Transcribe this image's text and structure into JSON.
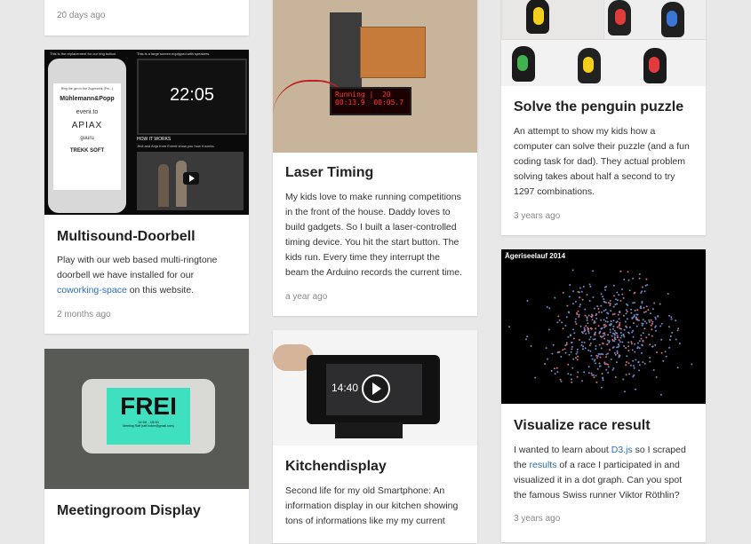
{
  "cards": {
    "c0": {
      "age": "20 days ago"
    },
    "doorbell": {
      "title": "Multisound-Doorbell",
      "desc_pre": "Play with our web based multi-ringtone doorbell we have installed for our ",
      "desc_link": "coworking-space",
      "desc_post": " on this website.",
      "age": "2 months ago",
      "thumb": {
        "caption_left": "This is the replacement for our ring button.",
        "caption_right": "This is a large screen equipped with speakers.",
        "phone_caption": "Ring the gen in the Zugerwerk (Pre...)",
        "logos": [
          "Mühlemann&Popp",
          "eveni.to",
          "APIAX",
          "guuru",
          "TREKK SOFT"
        ],
        "clock": "22:05",
        "how_title": "HOW IT WORKS",
        "how_text": "Jedi and Anja from Eventi show you how it works."
      }
    },
    "meeting": {
      "title": "Meetingroom Display",
      "thumb": {
        "label": "FREI",
        "sub1": "14:00 - 15:00",
        "sub2": "Meeting Raff (raff.hober@gmail.com)"
      }
    },
    "laser": {
      "title": "Laser Timing",
      "desc": "My kids love to make running competitions in the front of the house. Daddy loves to build gadgets. So I built a laser-controlled timing device. You hit the start button. The kids run. Every time they interrupt the beam the Arduino records the current time.",
      "age": "a year ago",
      "thumb": {
        "lcd_line1": "Running |  20",
        "lcd_line2": "00:13.9  00:05.7"
      }
    },
    "kitchen": {
      "title": "Kitchendisplay",
      "desc": "Second life for my old Smartphone: An information display in our kitchen showing tons of informations like my my current",
      "thumb": {
        "clock": "14:40"
      }
    },
    "penguin": {
      "title": "Solve the penguin puzzle",
      "desc": "An attempt to show my kids how a computer can solve their puzzle (and a fun coding task for dad). They actual problem solving takes about half a second to try 1297 combinations.",
      "age": "3 years ago"
    },
    "race": {
      "title": "Visualize race result",
      "desc_a": "I wanted to learn about ",
      "link1": "D3.js",
      "desc_b": " so I scraped the ",
      "link2": "results",
      "desc_c": " of a race I participated in and visualized it in a dot graph. Can you spot the famous Swiss runner Viktor Röthlin?",
      "age": "3 years ago",
      "thumb": {
        "chart_title": "Ägeriseelauf 2014"
      }
    }
  },
  "colors": {
    "link": "#2b6fb6",
    "background": "#e8e8e8",
    "lcd": "#ff3b3b",
    "frei_screen": "#3fe0c0"
  }
}
